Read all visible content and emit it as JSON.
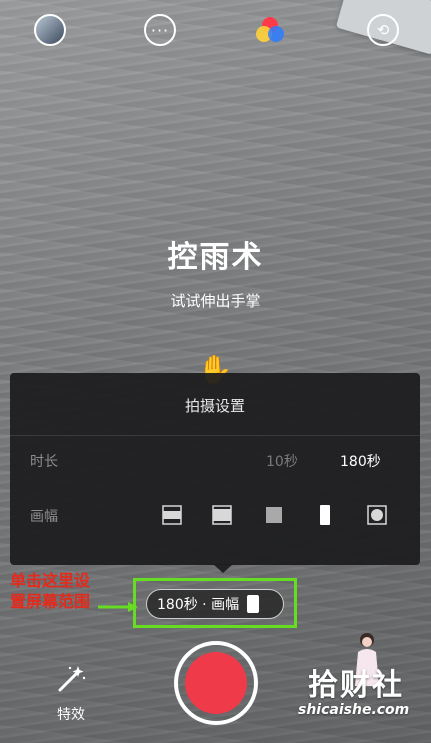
{
  "effect": {
    "title": "控雨术",
    "hint": "试试伸出手掌"
  },
  "topbar": {
    "icons": [
      "avatar",
      "more-icon",
      "filter-icon",
      "flip-camera-icon"
    ]
  },
  "settings_panel": {
    "title": "拍摄设置",
    "duration": {
      "label": "时长",
      "options": [
        "10秒",
        "180秒"
      ],
      "selected": "180秒"
    },
    "frame": {
      "label": "画幅",
      "options": [
        "wide-frame-icon",
        "landscape-frame-icon",
        "square-frame-icon",
        "portrait-frame-icon",
        "circle-frame-icon"
      ],
      "selected": "portrait-frame-icon"
    }
  },
  "setting_pill": {
    "label": "180秒 · 画幅"
  },
  "annotation": {
    "text": "单击这里设置屏幕范围",
    "color": "#e52a1c",
    "highlight_color": "#66dd22"
  },
  "bottombar": {
    "effects_label": "特效",
    "record_color": "#ef3a4a"
  },
  "watermark": {
    "title": "拾财社",
    "site": "shicaishe.com"
  }
}
